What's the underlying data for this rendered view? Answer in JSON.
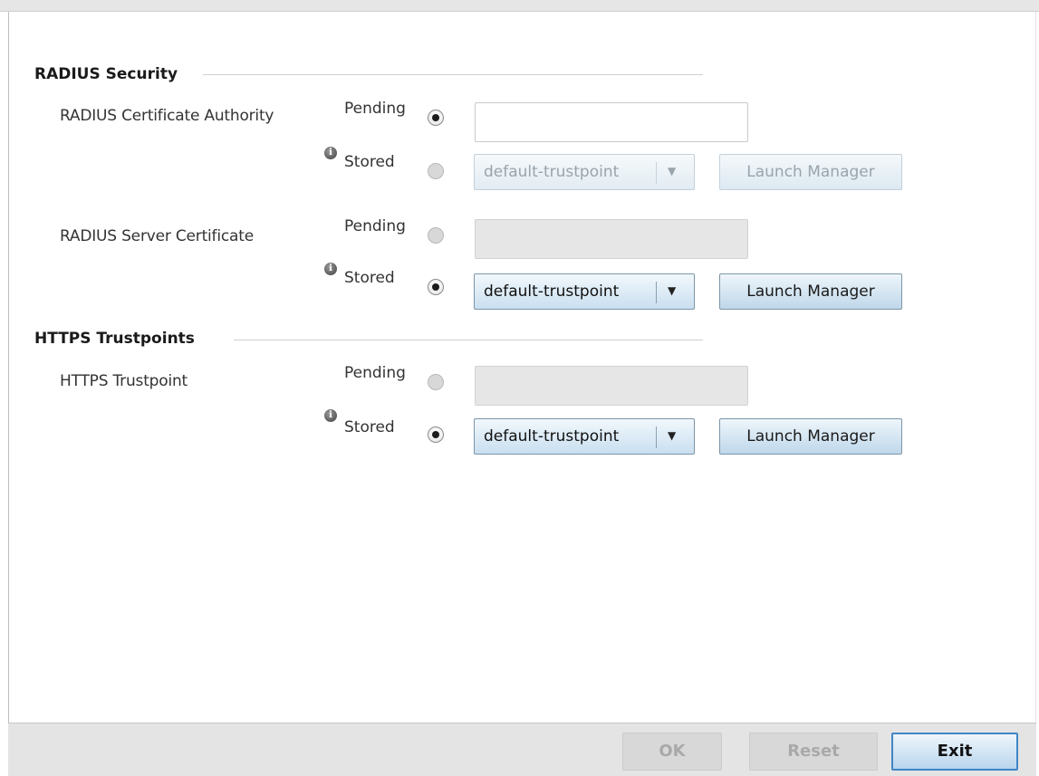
{
  "sections": {
    "radius_security": "RADIUS Security",
    "https_trustpoints": "HTTPS Trustpoints"
  },
  "rows": [
    {
      "label": "RADIUS Certificate Authority",
      "pending_label": "Pending",
      "stored_label": "Stored",
      "selected": "Pending",
      "pending_value": "",
      "stored_value": "default-trustpoint",
      "launch_label": "Launch Manager"
    },
    {
      "label": "RADIUS Server Certificate",
      "pending_label": "Pending",
      "stored_label": "Stored",
      "selected": "Stored",
      "pending_value": "",
      "stored_value": "default-trustpoint",
      "launch_label": "Launch Manager"
    },
    {
      "label": "HTTPS Trustpoint",
      "pending_label": "Pending",
      "stored_label": "Stored",
      "selected": "Stored",
      "pending_value": "",
      "stored_value": "default-trustpoint",
      "launch_label": "Launch Manager"
    }
  ],
  "footer": {
    "ok_label": "OK",
    "reset_label": "Reset",
    "exit_label": "Exit"
  }
}
